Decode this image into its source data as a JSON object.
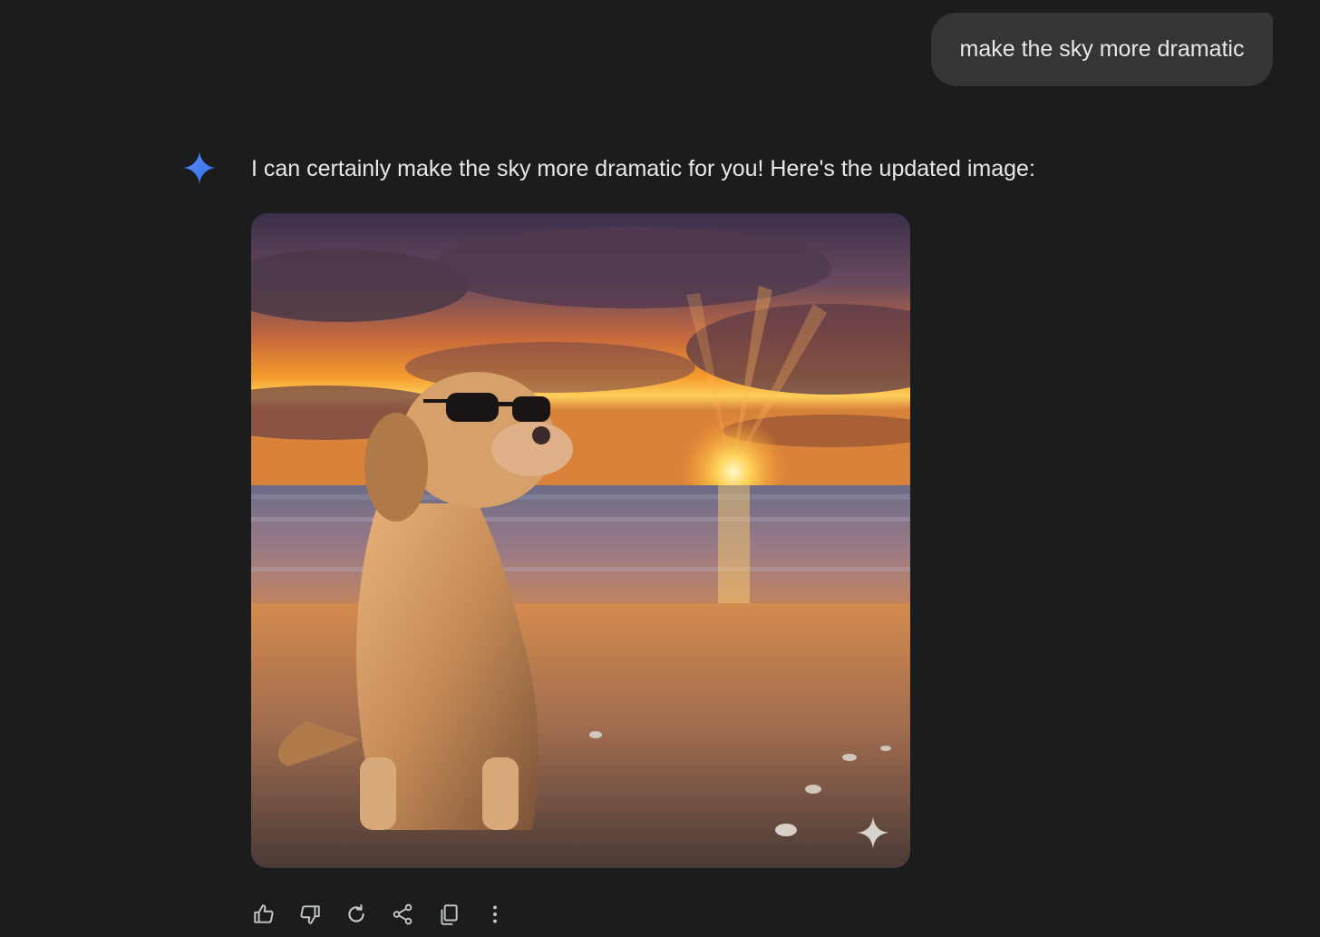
{
  "user_message": "make the sky more dramatic",
  "response": {
    "text": "I can certainly make the sky more dramatic for you! Here's the updated image:"
  },
  "image": {
    "subject": "golden retriever wearing sunglasses on beach at sunset",
    "watermark_icon": "sparkle-icon"
  },
  "actions": [
    {
      "name": "thumbs-up-icon"
    },
    {
      "name": "thumbs-down-icon"
    },
    {
      "name": "regenerate-icon"
    },
    {
      "name": "share-icon"
    },
    {
      "name": "copy-icon"
    },
    {
      "name": "more-options-icon"
    }
  ],
  "colors": {
    "background": "#1b1c1e",
    "user_bubble": "#333537",
    "text": "#e8e8e8",
    "icon": "#c4c7c5",
    "sparkle_blue": "#4285f4"
  }
}
